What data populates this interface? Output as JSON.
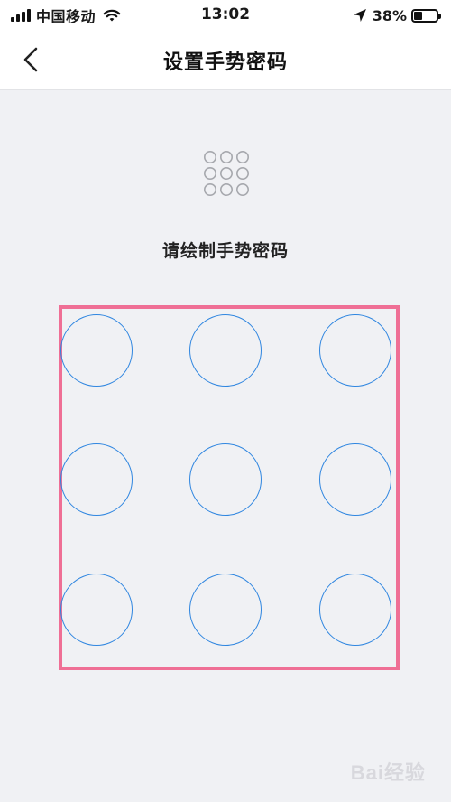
{
  "status_bar": {
    "carrier": "中国移动",
    "time": "13:02",
    "battery_percent": "38%",
    "battery_level": 0.38
  },
  "nav": {
    "title": "设置手势密码",
    "back_icon": "chevron-left-icon"
  },
  "content": {
    "grid_icon": "pattern-grid-icon",
    "prompt": "请绘制手势密码"
  },
  "pattern_nodes": [
    1,
    2,
    3,
    4,
    5,
    6,
    7,
    8,
    9
  ],
  "colors": {
    "node_stroke": "#2f86e0",
    "highlight_frame": "#ef6f95",
    "background": "#f0f1f4"
  },
  "watermark": "Bai经验"
}
